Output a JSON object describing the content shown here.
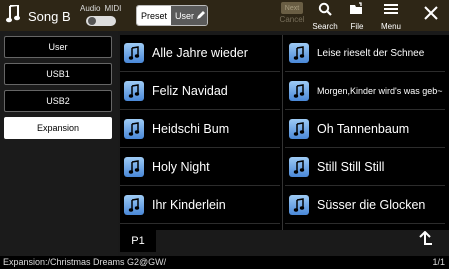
{
  "header": {
    "title": "Song B",
    "audio_label": "Audio",
    "midi_label": "MIDI",
    "preset_label": "Preset",
    "user_label": "User",
    "next_label": "Next",
    "cancel_label": "Cancel",
    "search_label": "Search",
    "file_label": "File",
    "menu_label": "Menu"
  },
  "sidebar": {
    "items": [
      {
        "label": "User"
      },
      {
        "label": "USB1"
      },
      {
        "label": "USB2"
      },
      {
        "label": "Expansion"
      }
    ]
  },
  "songs": {
    "left": [
      {
        "name": "Alle Jahre wieder"
      },
      {
        "name": "Feliz Navidad"
      },
      {
        "name": "Heidschi Bum"
      },
      {
        "name": "Holy Night"
      },
      {
        "name": "Ihr Kinderlein"
      }
    ],
    "right": [
      {
        "name": "Leise rieselt der Schnee"
      },
      {
        "name": "Morgen,Kinder wird's was geb~"
      },
      {
        "name": "Oh Tannenbaum"
      },
      {
        "name": "Still Still Still"
      },
      {
        "name": "Süsser die Glocken"
      }
    ]
  },
  "page_tab": "P1",
  "footer": {
    "path": "Expansion:/Christmas Dreams G2@GW/",
    "page": "1/1"
  }
}
